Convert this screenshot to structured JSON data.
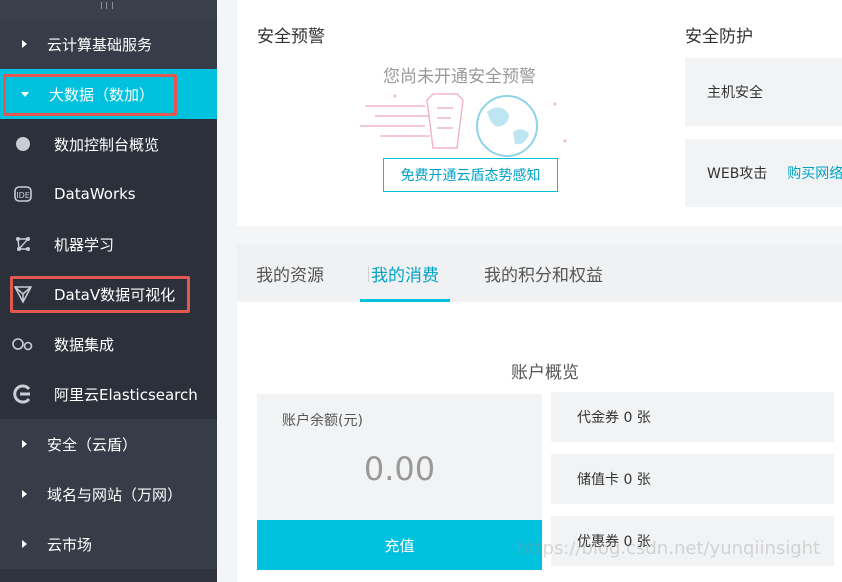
{
  "sidebar": {
    "items": [
      {
        "label": "云计算基础服务",
        "type": "category"
      },
      {
        "label": "大数据（数加）",
        "type": "category-open"
      },
      {
        "label": "数加控制台概览",
        "type": "sub",
        "icon": "circle-icon"
      },
      {
        "label": "DataWorks",
        "type": "sub",
        "icon": "dataworks-icon"
      },
      {
        "label": "机器学习",
        "type": "sub",
        "icon": "machine-learning-icon"
      },
      {
        "label": "DataV数据可视化",
        "type": "sub",
        "icon": "datav-icon"
      },
      {
        "label": "数据集成",
        "type": "sub",
        "icon": "data-integration-icon"
      },
      {
        "label": "阿里云Elasticsearch",
        "type": "sub",
        "icon": "elasticsearch-icon"
      },
      {
        "label": "安全（云盾）",
        "type": "category"
      },
      {
        "label": "域名与网站（万网）",
        "type": "category"
      },
      {
        "label": "云市场",
        "type": "category"
      }
    ]
  },
  "security_alert": {
    "title": "安全预警",
    "message": "您尚未开通安全预警",
    "button": "免费开通云盾态势感知"
  },
  "security_protection": {
    "title": "安全防护",
    "rows": [
      {
        "label": "主机安全",
        "link": ""
      },
      {
        "label": "WEB攻击",
        "link": "购买网络"
      }
    ]
  },
  "tabs": [
    {
      "label": "我的资源",
      "active": false
    },
    {
      "label": "我的消费",
      "active": true
    },
    {
      "label": "我的积分和权益",
      "active": false
    }
  ],
  "account": {
    "title": "账户概览",
    "balance_label": "账户余额(元)",
    "balance_value": "0.00",
    "recharge_label": "充值",
    "coupons": [
      {
        "label": "代金券 0 张"
      },
      {
        "label": "储值卡 0 张"
      },
      {
        "label": "优惠券 0 张"
      }
    ]
  },
  "watermark": "https://blog.csdn.net/yunqiinsight",
  "colors": {
    "accent": "#00c1de",
    "sidebar_bg": "#2f3440",
    "highlight_box": "#e2584e"
  }
}
